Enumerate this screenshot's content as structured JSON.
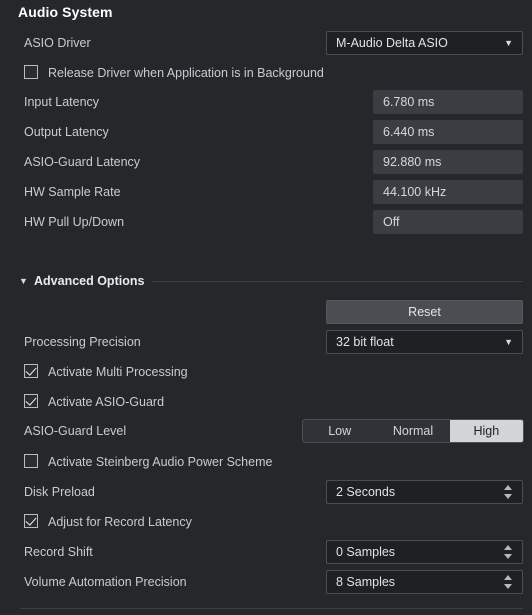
{
  "section": {
    "title": "Audio System"
  },
  "driver": {
    "label": "ASIO Driver",
    "value": "M-Audio Delta ASIO",
    "arrow": "▼"
  },
  "release_driver": {
    "label": "Release Driver when Application is in Background",
    "checked": false
  },
  "latency_fields": [
    {
      "label": "Input Latency",
      "value": "6.780 ms"
    },
    {
      "label": "Output Latency",
      "value": "6.440 ms"
    },
    {
      "label": "ASIO-Guard Latency",
      "value": "92.880 ms"
    },
    {
      "label": "HW Sample Rate",
      "value": "44.100 kHz"
    },
    {
      "label": "HW Pull Up/Down",
      "value": "Off"
    }
  ],
  "advanced": {
    "title": "Advanced Options",
    "triangle": "▼",
    "reset_label": "Reset",
    "processing_precision": {
      "label": "Processing Precision",
      "value": "32 bit float",
      "arrow": "▼"
    },
    "multi_processing": {
      "label": "Activate Multi Processing",
      "checked": true
    },
    "asio_guard": {
      "label": "Activate ASIO-Guard",
      "checked": true
    },
    "asio_guard_level": {
      "label": "ASIO-Guard Level",
      "options": [
        "Low",
        "Normal",
        "High"
      ],
      "selected": "High"
    },
    "power_scheme": {
      "label": "Activate Steinberg Audio Power Scheme",
      "checked": false
    },
    "disk_preload": {
      "label": "Disk Preload",
      "value": "2 Seconds"
    },
    "adjust_record_latency": {
      "label": "Adjust for Record Latency",
      "checked": true
    },
    "record_shift": {
      "label": "Record Shift",
      "value": "0 Samples"
    },
    "volume_automation_precision": {
      "label": "Volume Automation Precision",
      "value": "8 Samples"
    }
  }
}
